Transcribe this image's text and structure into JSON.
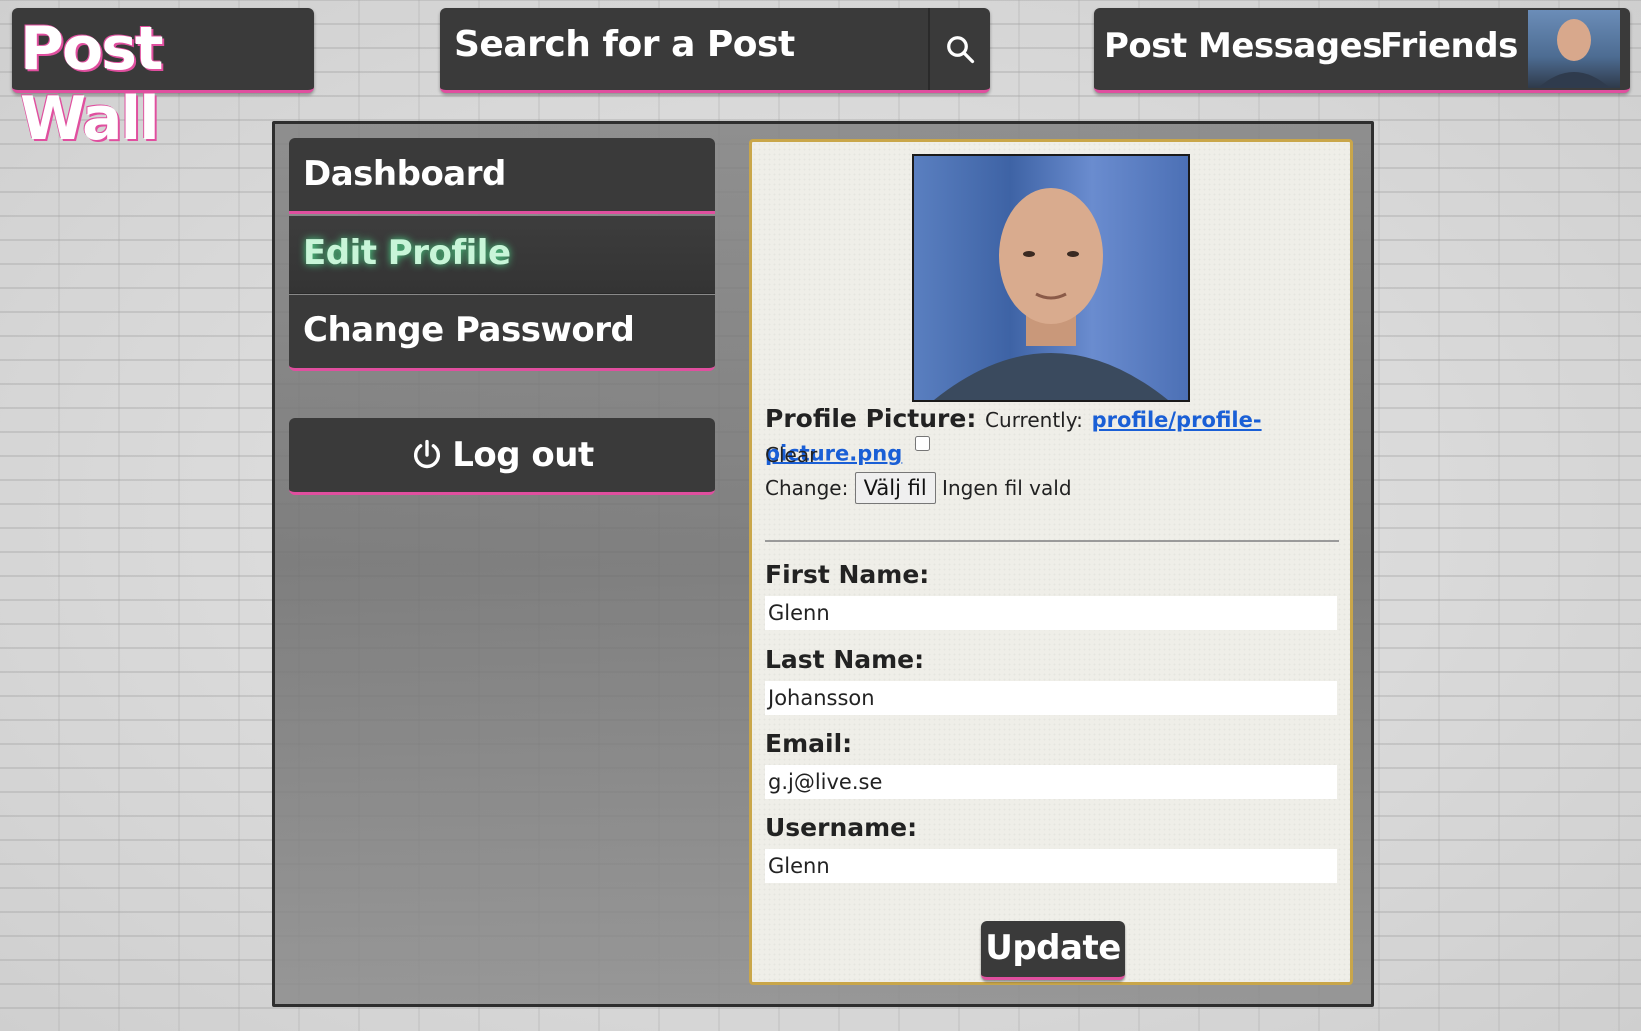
{
  "header": {
    "logo": "Post Wall",
    "search_placeholder": "Search for a Post",
    "nav": {
      "post": "Post",
      "messages": "Messages",
      "friends": "Friends"
    }
  },
  "sidebar": {
    "items": [
      {
        "label": "Dashboard",
        "active": false
      },
      {
        "label": "Edit Profile",
        "active": true
      },
      {
        "label": "Change Password",
        "active": false
      }
    ],
    "logout": "Log out"
  },
  "form": {
    "profile_picture_label": "Profile Picture:",
    "currently_label": "Currently:",
    "current_file": "profile/profile-picture.png",
    "clear_label": "Clear",
    "change_label": "Change:",
    "choose_file_button": "Välj fil",
    "no_file_chosen": "Ingen fil vald",
    "fields": [
      {
        "label": "First Name:",
        "value": "Glenn"
      },
      {
        "label": "Last Name:",
        "value": "Johansson"
      },
      {
        "label": "Email:",
        "value": "g.j@live.se"
      },
      {
        "label": "Username:",
        "value": "Glenn"
      }
    ],
    "submit": "Update"
  },
  "colors": {
    "panel_dark": "#3a3a3a",
    "accent_pink": "#e04f9f",
    "active_glow": "#4cd98a",
    "card_border": "#c9a64a",
    "link_blue": "#1a5fd6"
  },
  "icons": {
    "search": "search-icon",
    "power": "power-icon"
  }
}
